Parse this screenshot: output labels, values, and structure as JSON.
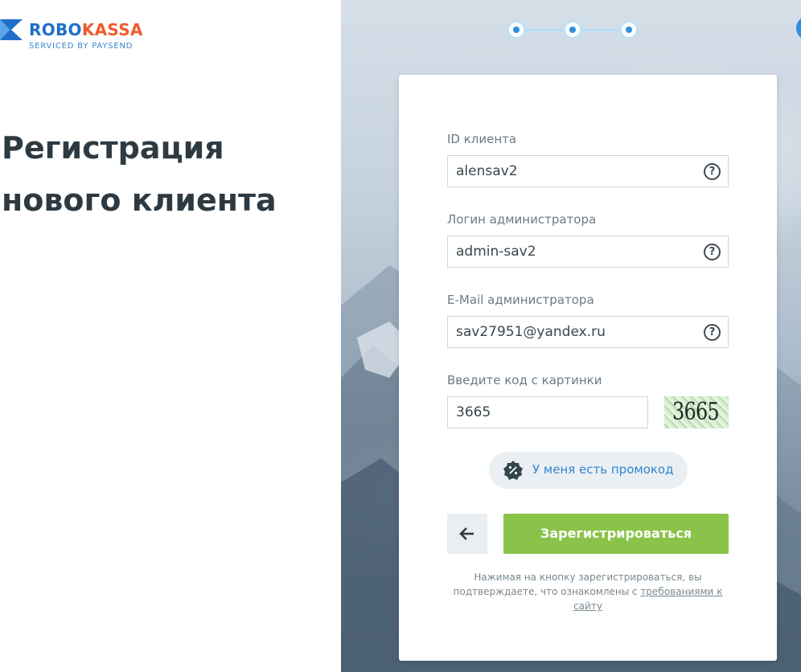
{
  "brand": {
    "name_part1": "ROBO",
    "name_part2": "KASSA",
    "subtitle": "SERVICED BY PAYSEND",
    "primary_color": "#1f6fc8",
    "accent_color": "#ef5a2b"
  },
  "page": {
    "title": "Регистрация нового клиента"
  },
  "stepper": {
    "total_steps": 3,
    "current_step": 3
  },
  "form": {
    "client_id": {
      "label": "ID клиента",
      "value": "alensav2",
      "help_icon": "question-circle-icon"
    },
    "admin_login": {
      "label": "Логин администратора",
      "value": "admin-sav2",
      "help_icon": "question-circle-icon"
    },
    "admin_email": {
      "label": "E-Mail администратора",
      "value": "sav27951@yandex.ru",
      "help_icon": "question-circle-icon"
    },
    "captcha": {
      "label": "Введите код с картинки",
      "value": "3665",
      "image_text": "3665"
    }
  },
  "promo": {
    "label": "У меня есть промокод",
    "icon": "promo-badge-icon"
  },
  "actions": {
    "back_icon": "arrow-left-icon",
    "submit_label": "Зарегистрироваться",
    "submit_color": "#8bc34a"
  },
  "terms": {
    "text": "Нажимая на кнопку зарегистрироваться, вы подтверждаете, что ознакомлены с",
    "link": "требованиями к сайту"
  }
}
